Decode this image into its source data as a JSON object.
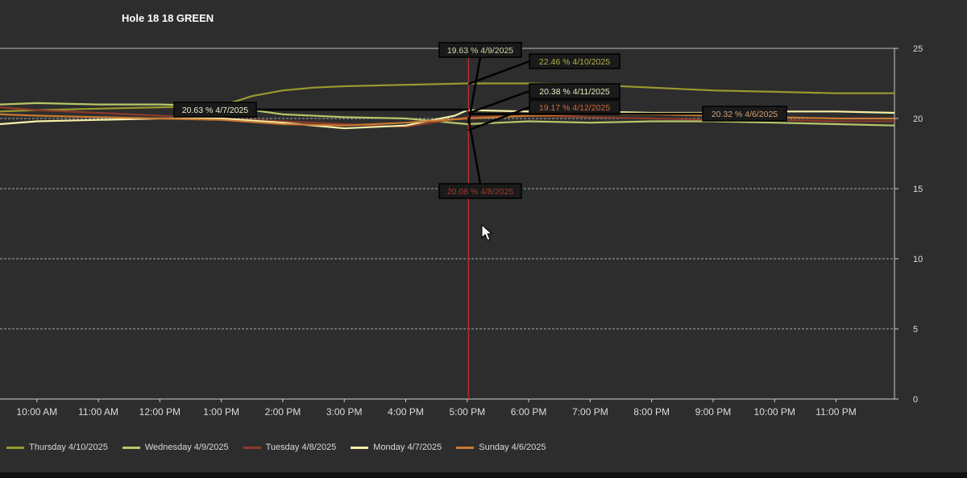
{
  "chart_data": {
    "type": "line",
    "title": "Hole 18 18 GREEN",
    "xlabel": "",
    "ylabel": "",
    "ylim": [
      0,
      25
    ],
    "y_ticks": [
      0,
      5,
      10,
      15,
      20,
      25
    ],
    "x_ticks": [
      "10:00 AM",
      "11:00 AM",
      "12:00 PM",
      "1:00 PM",
      "2:00 PM",
      "3:00 PM",
      "4:00 PM",
      "5:00 PM",
      "6:00 PM",
      "7:00 PM",
      "8:00 PM",
      "9:00 PM",
      "10:00 PM",
      "11:00 PM"
    ],
    "x_range_hours": [
      9.4,
      23.95
    ],
    "cursor_hour": 17.02,
    "grid": "horizontal-dashed",
    "legend_position": "bottom",
    "series": [
      {
        "name": "Thursday 4/10/2025",
        "color": "#9a9a2e",
        "x": [
          9.4,
          10.0,
          11.0,
          12.0,
          13.0,
          13.5,
          14.0,
          14.5,
          15.0,
          16.0,
          17.0,
          18.0,
          19.0,
          20.0,
          21.0,
          22.0,
          23.0,
          23.95
        ],
        "y": [
          20.5,
          20.6,
          20.7,
          20.8,
          20.9,
          21.6,
          22.0,
          22.2,
          22.3,
          22.4,
          22.5,
          22.5,
          22.4,
          22.2,
          22.0,
          21.9,
          21.8,
          21.8
        ]
      },
      {
        "name": "Wednesday 4/9/2025",
        "color": "#b8c66a",
        "x": [
          9.4,
          10.0,
          11.0,
          12.0,
          13.0,
          14.0,
          15.0,
          16.0,
          17.0,
          18.0,
          19.0,
          20.0,
          21.0,
          22.0,
          23.0,
          23.95
        ],
        "y": [
          21.0,
          21.1,
          21.0,
          21.0,
          20.9,
          20.3,
          20.1,
          20.0,
          19.6,
          19.8,
          19.7,
          19.8,
          19.8,
          19.7,
          19.6,
          19.5
        ]
      },
      {
        "name": "Tuesday 4/8/2025",
        "color": "#8b3a2a",
        "x": [
          9.4,
          10.0,
          11.0,
          12.0,
          13.0,
          14.0,
          15.0,
          16.0,
          17.0,
          18.0,
          19.0,
          20.0,
          21.0,
          22.0,
          23.0,
          23.95
        ],
        "y": [
          20.8,
          20.6,
          20.4,
          20.2,
          20.0,
          19.8,
          19.6,
          19.4,
          20.1,
          20.2,
          20.1,
          20.0,
          19.9,
          19.9,
          19.8,
          19.8
        ]
      },
      {
        "name": "Monday 4/7/2025",
        "color": "#f5f0a8",
        "x": [
          9.4,
          10.0,
          11.0,
          12.0,
          13.0,
          14.0,
          15.0,
          16.0,
          16.8,
          17.0,
          18.0,
          19.0,
          20.0,
          21.0,
          22.0,
          23.0,
          23.95
        ],
        "y": [
          19.6,
          19.8,
          19.9,
          20.0,
          20.0,
          19.7,
          19.3,
          19.5,
          20.2,
          20.6,
          20.5,
          20.5,
          20.4,
          20.4,
          20.5,
          20.5,
          20.4
        ]
      },
      {
        "name": "Sunday 4/6/2025",
        "color": "#c87a32",
        "x": [
          9.4,
          10.0,
          11.0,
          12.0,
          13.0,
          14.0,
          15.0,
          16.0,
          17.0,
          18.0,
          19.0,
          20.0,
          21.0,
          22.0,
          23.0,
          23.95
        ],
        "y": [
          20.3,
          20.2,
          20.1,
          20.0,
          19.9,
          19.6,
          19.5,
          19.7,
          20.0,
          20.2,
          20.3,
          20.3,
          20.2,
          20.1,
          20.0,
          20.0
        ]
      }
    ],
    "tooltips": [
      {
        "label": "19.63 % 4/9/2025",
        "color": "#d7d7a8"
      },
      {
        "label": "22.46 % 4/10/2025",
        "color": "#b2b24a"
      },
      {
        "label": "20.38 % 4/11/2025",
        "color": "#e2f0c0"
      },
      {
        "label": "19.17 % 4/12/2025",
        "color": "#d06a3a"
      },
      {
        "label": "20.63 % 4/7/2025",
        "color": "#f2eed0"
      },
      {
        "label": "20.32 % 4/6/2025",
        "color": "#d3a27a"
      },
      {
        "label": "20.08 % 4/8/2025",
        "color": "#a63a2a"
      }
    ]
  }
}
